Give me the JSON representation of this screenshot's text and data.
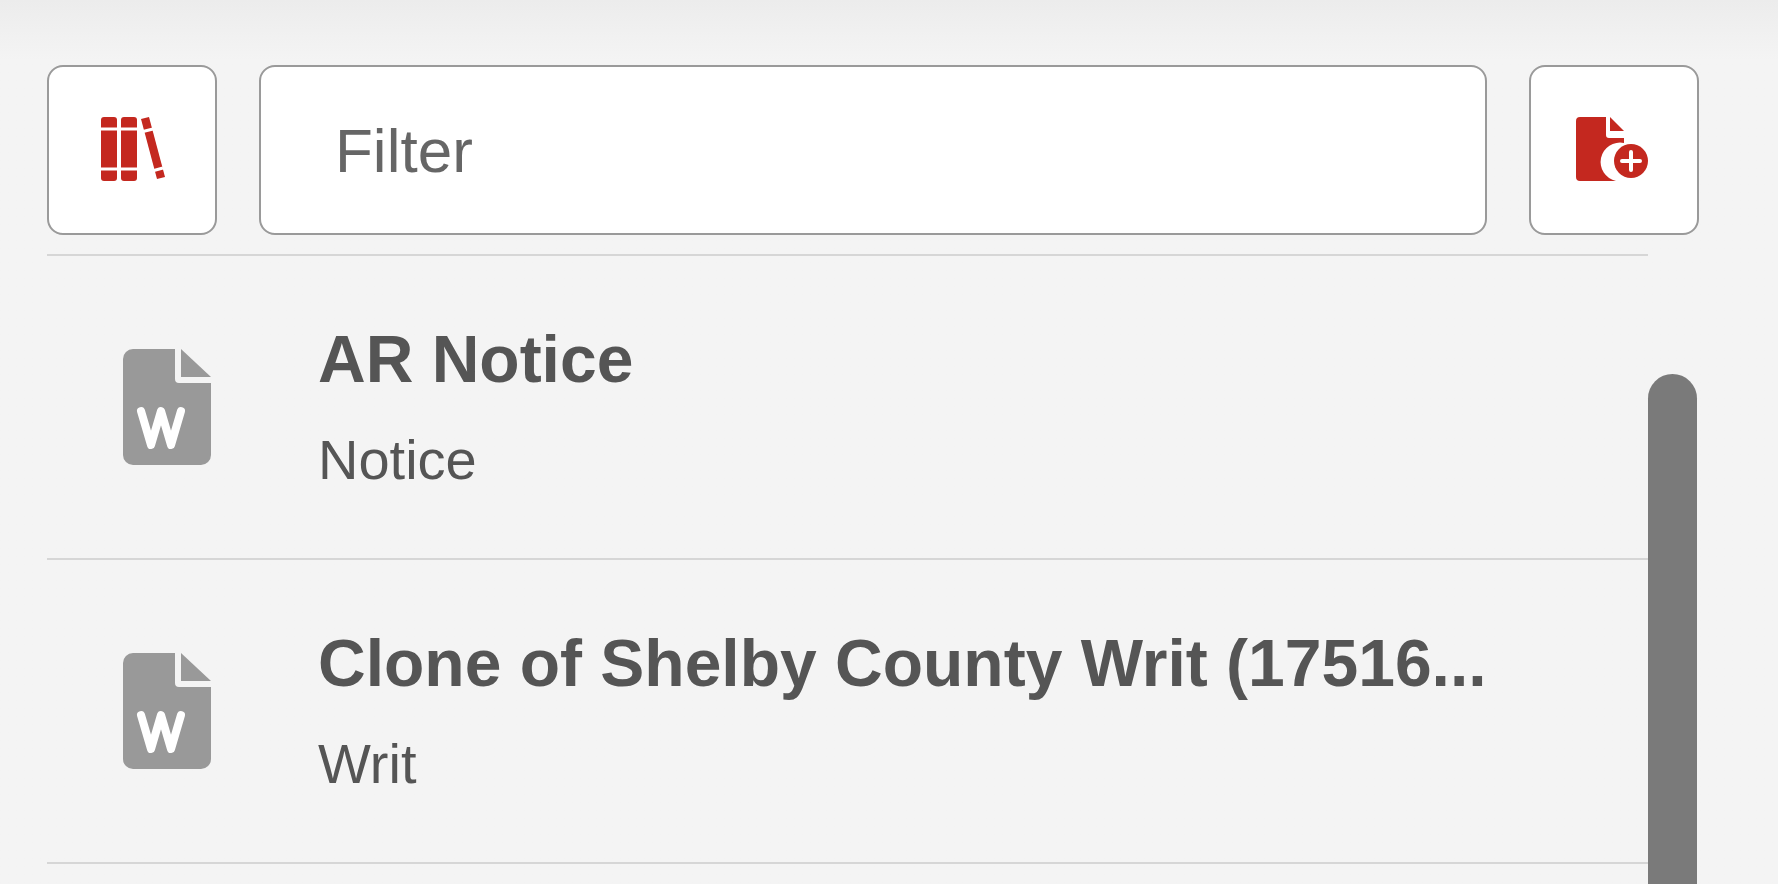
{
  "filter": {
    "placeholder": "Filter"
  },
  "documents": [
    {
      "title": "AR Notice",
      "type": "Notice"
    },
    {
      "title": "Clone of Shelby County Writ (17516...",
      "type": "Writ"
    }
  ]
}
